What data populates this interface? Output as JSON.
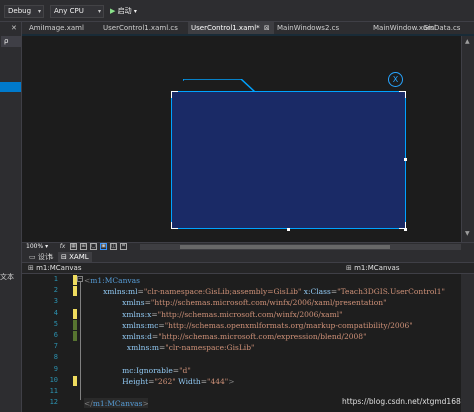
{
  "toolbar": {
    "configuration": "Debug",
    "platform": "Any CPU",
    "start_label": "启动"
  },
  "left_panel": {
    "search_glyph": "ρ",
    "side_text": "文本"
  },
  "tabs": [
    {
      "label": "AmiImage.xaml",
      "active": false
    },
    {
      "label": "UserControl1.xaml.cs",
      "active": false
    },
    {
      "label": "UserControl1.xaml*",
      "active": true
    },
    {
      "label": "MainWindows2.cs",
      "active": false
    },
    {
      "label": "MainWindow.xaml",
      "active": false
    },
    {
      "label": "GisData.cs",
      "active": false
    }
  ],
  "designer": {
    "close_glyph": "X",
    "zoom": "100%",
    "fx_label": "fx"
  },
  "view_tabs": {
    "design_label": "设计",
    "xaml_label": "XAML",
    "swap_glyph": "⇅"
  },
  "element_selector": {
    "left": "m1:MCanvas",
    "right": "m1:MCanvas"
  },
  "editor": {
    "line_numbers": [
      "1",
      "2",
      "3",
      "4",
      "5",
      "6",
      "7",
      "8",
      "9",
      "10",
      "11",
      "12"
    ],
    "lines": [
      {
        "segs": [
          {
            "c": "br",
            "t": "<"
          },
          {
            "c": "el",
            "t": "m1:MCanvas"
          }
        ]
      },
      {
        "segs": [
          {
            "c": "at",
            "t": "        xmlns:ml"
          },
          {
            "c": "eq",
            "t": "="
          },
          {
            "c": "st",
            "t": "\"clr-namespace:GisLib;assembly=GisLib\""
          },
          {
            "c": "at",
            "t": " x:Class"
          },
          {
            "c": "eq",
            "t": "="
          },
          {
            "c": "st",
            "t": "\"Teach3DGIS.UserControl1\""
          }
        ]
      },
      {
        "segs": [
          {
            "c": "at",
            "t": "                xmlns"
          },
          {
            "c": "eq",
            "t": "="
          },
          {
            "c": "st",
            "t": "\"http://schemas.microsoft.com/winfx/2006/xaml/presentation\""
          }
        ]
      },
      {
        "segs": [
          {
            "c": "at",
            "t": "                xmlns:x"
          },
          {
            "c": "eq",
            "t": "="
          },
          {
            "c": "st",
            "t": "\"http://schemas.microsoft.com/winfx/2006/xaml\""
          }
        ]
      },
      {
        "segs": [
          {
            "c": "at",
            "t": "                xmlns:mc"
          },
          {
            "c": "eq",
            "t": "="
          },
          {
            "c": "st",
            "t": "\"http://schemas.openxmlformats.org/markup-compatibility/2006\""
          }
        ]
      },
      {
        "segs": [
          {
            "c": "at",
            "t": "                xmlns:d"
          },
          {
            "c": "eq",
            "t": "="
          },
          {
            "c": "st",
            "t": "\"http://schemas.microsoft.com/expression/blend/2008\""
          }
        ]
      },
      {
        "segs": [
          {
            "c": "at",
            "t": "                  xmlns:m"
          },
          {
            "c": "eq",
            "t": "="
          },
          {
            "c": "st",
            "t": "\"clr-namespace:GisLib\""
          }
        ]
      },
      {
        "segs": []
      },
      {
        "segs": [
          {
            "c": "at",
            "t": "                mc:Ignorable"
          },
          {
            "c": "eq",
            "t": "="
          },
          {
            "c": "st",
            "t": "\"d\""
          }
        ]
      },
      {
        "segs": [
          {
            "c": "at",
            "t": "                Height"
          },
          {
            "c": "eq",
            "t": "="
          },
          {
            "c": "st",
            "t": "\"262\""
          },
          {
            "c": "at",
            "t": " Width"
          },
          {
            "c": "eq",
            "t": "="
          },
          {
            "c": "st",
            "t": "\"444\""
          },
          {
            "c": "br",
            "t": ">"
          }
        ]
      },
      {
        "segs": []
      },
      {
        "segs": [
          {
            "c": "br",
            "t": "</"
          },
          {
            "c": "el",
            "t": "m1:MCanvas"
          },
          {
            "c": "br",
            "t": ">"
          }
        ]
      }
    ]
  },
  "watermark": "https://blog.csdn.net/xtgmd168"
}
